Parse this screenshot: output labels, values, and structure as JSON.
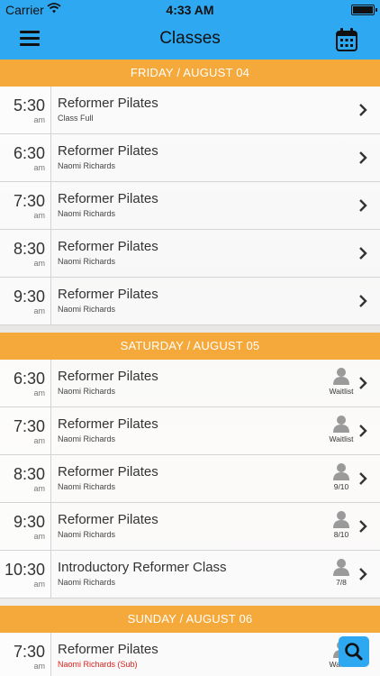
{
  "status_bar": {
    "carrier": "Carrier",
    "time": "4:33 AM"
  },
  "nav": {
    "title": "Classes",
    "menu_icon": "hamburger-menu-icon",
    "calendar_icon": "calendar-icon"
  },
  "sections": [
    {
      "header": "FRIDAY / AUGUST 04",
      "rows": [
        {
          "time": "5:30",
          "ampm": "am",
          "class_name": "Reformer Pilates",
          "instructor": "Class Full",
          "availability": ""
        },
        {
          "time": "6:30",
          "ampm": "am",
          "class_name": "Reformer Pilates",
          "instructor": "Naomi Richards",
          "availability": ""
        },
        {
          "time": "7:30",
          "ampm": "am",
          "class_name": "Reformer Pilates",
          "instructor": "Naomi Richards",
          "availability": ""
        },
        {
          "time": "8:30",
          "ampm": "am",
          "class_name": "Reformer Pilates",
          "instructor": "Naomi Richards",
          "availability": ""
        },
        {
          "time": "9:30",
          "ampm": "am",
          "class_name": "Reformer Pilates",
          "instructor": "Naomi Richards",
          "availability": ""
        }
      ]
    },
    {
      "header": "SATURDAY / AUGUST 05",
      "rows": [
        {
          "time": "6:30",
          "ampm": "am",
          "class_name": "Reformer Pilates",
          "instructor": "Naomi Richards",
          "availability": "Waitlist"
        },
        {
          "time": "7:30",
          "ampm": "am",
          "class_name": "Reformer Pilates",
          "instructor": "Naomi Richards",
          "availability": "Waitlist"
        },
        {
          "time": "8:30",
          "ampm": "am",
          "class_name": "Reformer Pilates",
          "instructor": "Naomi Richards",
          "availability": "9/10"
        },
        {
          "time": "9:30",
          "ampm": "am",
          "class_name": "Reformer Pilates",
          "instructor": "Naomi Richards",
          "availability": "8/10"
        },
        {
          "time": "10:30",
          "ampm": "am",
          "class_name": "Introductory Reformer Class",
          "instructor": "Naomi Richards",
          "availability": "7/8"
        }
      ]
    },
    {
      "header": "SUNDAY / AUGUST 06",
      "rows": [
        {
          "time": "7:30",
          "ampm": "am",
          "class_name": "Reformer Pilates",
          "instructor": "Naomi Richards (Sub)",
          "availability": "Waitlist"
        }
      ]
    }
  ],
  "colors": {
    "nav_blue": "#2ea8f1",
    "section_orange": "#f6a93b",
    "sub_red": "#e0211a"
  },
  "fab": {
    "icon": "search-icon"
  }
}
